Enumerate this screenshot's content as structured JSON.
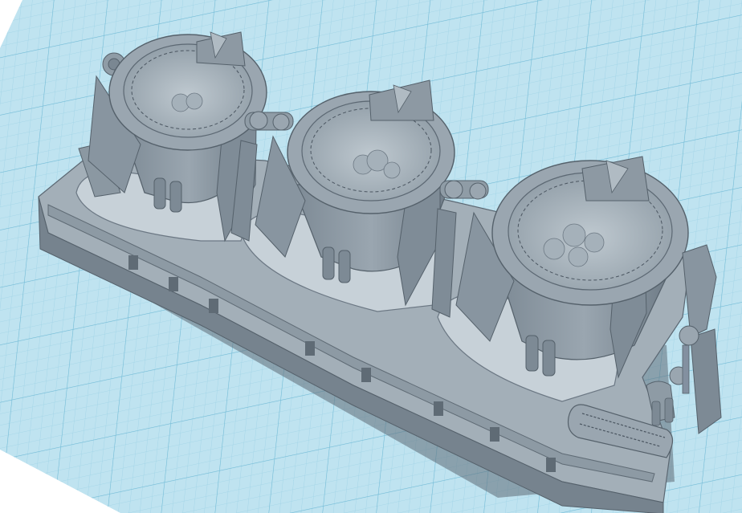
{
  "viewport": {
    "background": "#ffffff",
    "workplane_color": "#b9e0ee",
    "grid_minor_color": "#8fcbe0",
    "grid_major_color": "#5fb0cf"
  },
  "model": {
    "body_color": "#8c9aa5",
    "body_dark": "#6a7782",
    "body_light": "#aab6bf",
    "highlight": "#c4ced6",
    "inner_surface": "#b4c0c8",
    "cup_count": 3,
    "icons": [
      "carburetor-body",
      "float-bowl",
      "intake-funnel"
    ]
  }
}
